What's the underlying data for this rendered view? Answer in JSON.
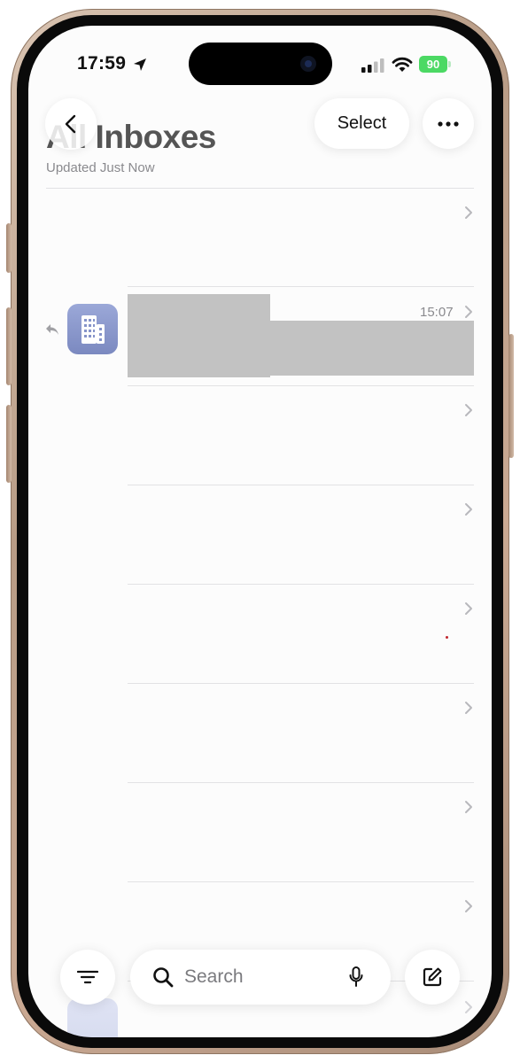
{
  "status_bar": {
    "time": "17:59",
    "battery": "90"
  },
  "header": {
    "title": "All Inboxes",
    "subtitle": "Updated Just Now",
    "select_label": "Select"
  },
  "messages": [
    {
      "time": "15:07"
    }
  ],
  "toolbar": {
    "search_placeholder": "Search"
  },
  "colors": {
    "accent_battery": "#4cd964",
    "app_icon": "#8593c9",
    "redaction": "#c2c2c2"
  }
}
